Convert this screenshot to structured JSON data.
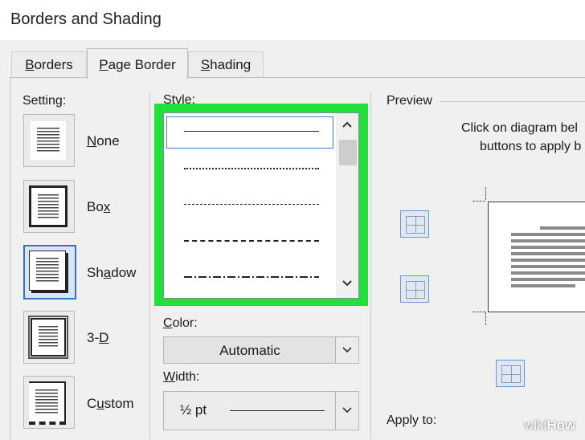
{
  "window": {
    "title": "Borders and Shading"
  },
  "tabs": [
    {
      "label": "Borders",
      "underline": "B",
      "rest": "orders",
      "active": false
    },
    {
      "label": "Page Border",
      "underline": "P",
      "rest": "age Border",
      "active": true
    },
    {
      "label": "Shading",
      "underline": "S",
      "rest": "hading",
      "active": false
    }
  ],
  "setting": {
    "heading": "Setting:",
    "options": [
      {
        "pre": "",
        "u": "N",
        "post": "one",
        "selected": false
      },
      {
        "pre": "Bo",
        "u": "x",
        "post": "",
        "selected": false
      },
      {
        "pre": "Sh",
        "u": "a",
        "post": "dow",
        "selected": true
      },
      {
        "pre": "3-",
        "u": "D",
        "post": "",
        "selected": false
      },
      {
        "pre": "C",
        "u": "u",
        "post": "stom",
        "selected": false
      }
    ]
  },
  "style": {
    "heading_u": "S",
    "heading_rest": "tyle:",
    "highlight_color": "#22e03a",
    "lines": [
      "solid",
      "dotted",
      "fine-dashed",
      "dashed",
      "dash-dot"
    ],
    "scroll_up": "^",
    "scroll_down": "v"
  },
  "color": {
    "label_u": "C",
    "label_rest": "olor:",
    "value": "Automatic"
  },
  "width": {
    "label_u": "W",
    "label_rest": "idth:",
    "value": "½ pt"
  },
  "preview": {
    "heading": "Preview",
    "instruction_line1": "Click on diagram bel",
    "instruction_line2": "buttons to apply b"
  },
  "apply": {
    "label_pre": "Apply to:"
  },
  "watermark": {
    "wiki": "wiki",
    "how": "How"
  }
}
